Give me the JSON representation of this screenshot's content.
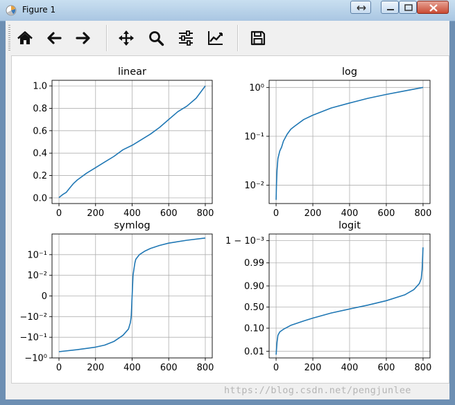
{
  "window": {
    "title": "Figure 1",
    "app_icon": "matplotlib-icon",
    "controls": [
      "resize-icon",
      "minimize-icon",
      "maximize-icon",
      "close-icon"
    ]
  },
  "toolbar": {
    "buttons": [
      {
        "name": "home-button",
        "icon": "home-icon"
      },
      {
        "name": "back-button",
        "icon": "back-arrow-icon"
      },
      {
        "name": "forward-button",
        "icon": "forward-arrow-icon"
      },
      {
        "name": "pan-button",
        "icon": "move-icon"
      },
      {
        "name": "zoom-button",
        "icon": "zoom-icon"
      },
      {
        "name": "configure-subplots-button",
        "icon": "sliders-icon"
      },
      {
        "name": "edit-axis-button",
        "icon": "edit-curve-icon"
      },
      {
        "name": "save-button",
        "icon": "save-icon"
      }
    ]
  },
  "statusbar": {
    "message": ""
  },
  "watermark": "https://blog.csdn.net/pengjunlee",
  "colors": {
    "line": "#1f77b4",
    "grid": "#b0b0b0",
    "axes": "#000000"
  },
  "chart_data": [
    {
      "type": "line",
      "title": "linear",
      "yscale": "linear",
      "xlim": [
        -38,
        838
      ],
      "ylim": [
        -0.05,
        1.05
      ],
      "xticks": [
        0,
        200,
        400,
        600,
        800
      ],
      "xtick_labels": [
        "0",
        "200",
        "400",
        "600",
        "800"
      ],
      "yticks": [
        0.0,
        0.2,
        0.4,
        0.6,
        0.8,
        1.0
      ],
      "ytick_labels": [
        "0.0",
        "0.2",
        "0.4",
        "0.6",
        "0.8",
        "1.0"
      ],
      "grid": true,
      "x": [
        0,
        20,
        40,
        60,
        80,
        100,
        150,
        200,
        250,
        300,
        350,
        400,
        450,
        500,
        550,
        600,
        650,
        700,
        750,
        800
      ],
      "y": [
        0.003,
        0.03,
        0.05,
        0.09,
        0.13,
        0.16,
        0.22,
        0.27,
        0.32,
        0.37,
        0.43,
        0.47,
        0.52,
        0.57,
        0.63,
        0.7,
        0.77,
        0.82,
        0.89,
        1.0
      ]
    },
    {
      "type": "line",
      "title": "log",
      "yscale": "log",
      "xlim": [
        -38,
        838
      ],
      "ylim": [
        0.0042,
        1.4
      ],
      "xticks": [
        0,
        200,
        400,
        600,
        800
      ],
      "xtick_labels": [
        "0",
        "200",
        "400",
        "600",
        "800"
      ],
      "yticks": [
        0.01,
        0.1,
        1
      ],
      "ytick_labels": [
        "10⁻²",
        "10⁻¹",
        "10⁰"
      ],
      "grid": true,
      "x": [
        0,
        2,
        5,
        10,
        20,
        30,
        40,
        60,
        80,
        100,
        150,
        200,
        300,
        400,
        500,
        600,
        700,
        800
      ],
      "y": [
        0.005,
        0.01,
        0.02,
        0.035,
        0.05,
        0.06,
        0.08,
        0.11,
        0.14,
        0.16,
        0.22,
        0.27,
        0.38,
        0.48,
        0.6,
        0.72,
        0.85,
        1.0
      ]
    },
    {
      "type": "line",
      "title": "symlog",
      "yscale": "symlog",
      "linthresh": 0.01,
      "xlim": [
        -38,
        838
      ],
      "ylim": [
        -1.0,
        1.0
      ],
      "xticks": [
        0,
        200,
        400,
        600,
        800
      ],
      "xtick_labels": [
        "0",
        "200",
        "400",
        "600",
        "800"
      ],
      "yticks": [
        -1.0,
        -0.1,
        -0.01,
        0,
        0.01,
        0.1
      ],
      "ytick_labels": [
        "−10⁰",
        "−10⁻¹",
        "−10⁻²",
        "0",
        "10⁻²",
        "10⁻¹"
      ],
      "grid": true,
      "x": [
        0,
        100,
        200,
        250,
        300,
        350,
        380,
        390,
        395,
        400,
        405,
        410,
        415,
        420,
        440,
        470,
        500,
        550,
        600,
        700,
        800
      ],
      "y": [
        -0.5,
        -0.4,
        -0.3,
        -0.24,
        -0.16,
        -0.08,
        -0.04,
        -0.02,
        -0.01,
        0.0,
        0.01,
        0.02,
        0.04,
        0.06,
        0.1,
        0.15,
        0.2,
        0.28,
        0.36,
        0.5,
        0.64
      ]
    },
    {
      "type": "line",
      "title": "logit",
      "yscale": "logit",
      "xlim": [
        -38,
        838
      ],
      "ylim": [
        0.005,
        0.9995
      ],
      "xticks": [
        0,
        200,
        400,
        600,
        800
      ],
      "xtick_labels": [
        "0",
        "200",
        "400",
        "600",
        "800"
      ],
      "yticks": [
        0.01,
        0.1,
        0.5,
        0.9,
        0.99,
        0.999
      ],
      "ytick_labels": [
        "0.01",
        "0.10",
        "0.50",
        "0.90",
        "0.99",
        "1 − 10⁻³"
      ],
      "grid": true,
      "x": [
        0,
        5,
        10,
        20,
        40,
        80,
        150,
        200,
        300,
        400,
        500,
        600,
        700,
        750,
        780,
        790,
        795,
        800
      ],
      "y": [
        0.007,
        0.025,
        0.05,
        0.07,
        0.09,
        0.13,
        0.19,
        0.24,
        0.35,
        0.45,
        0.55,
        0.66,
        0.78,
        0.86,
        0.92,
        0.95,
        0.98,
        0.998
      ]
    }
  ]
}
